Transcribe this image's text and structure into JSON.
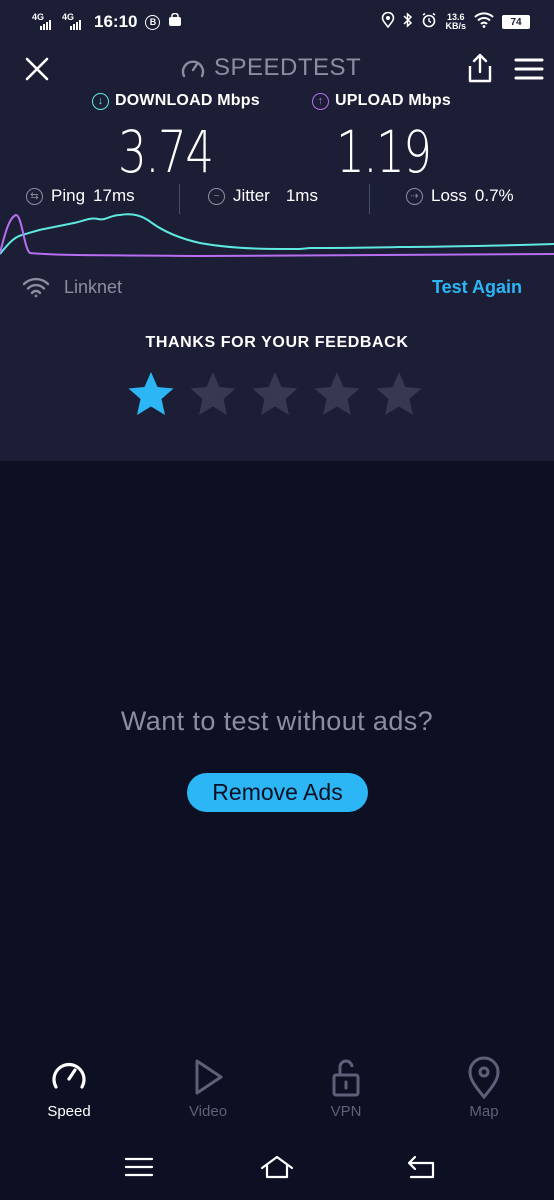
{
  "status_bar": {
    "network1": "4G",
    "network2": "4G",
    "time": "16:10",
    "badge_b": "B",
    "speed_value": "13.6",
    "speed_unit": "KB/s",
    "battery": "74"
  },
  "header": {
    "title": "SPEEDTEST"
  },
  "results": {
    "download_label": "DOWNLOAD Mbps",
    "download_value": "3.74",
    "upload_label": "UPLOAD Mbps",
    "upload_value": "1.19",
    "ping_label": "Ping",
    "ping_value": "17ms",
    "jitter_label": "Jitter",
    "jitter_value": "1ms",
    "loss_label": "Loss",
    "loss_value": "0.7%"
  },
  "connection": {
    "isp": "Linknet",
    "test_again_label": "Test Again"
  },
  "feedback": {
    "title": "THANKS FOR YOUR FEEDBACK",
    "rating": 1,
    "max_rating": 5
  },
  "promo": {
    "question": "Want to test without ads?",
    "button_label": "Remove Ads"
  },
  "tabs": [
    {
      "label": "Speed",
      "icon": "speedometer-icon",
      "active": true
    },
    {
      "label": "Video",
      "icon": "play-icon",
      "active": false
    },
    {
      "label": "VPN",
      "icon": "unlock-icon",
      "active": false
    },
    {
      "label": "Map",
      "icon": "map-pin-icon",
      "active": false
    }
  ],
  "colors": {
    "accent": "#2cb6f5",
    "download": "#5ee8e0",
    "upload": "#b86ef0",
    "panel": "#1c1e35",
    "background": "#0d0f22",
    "muted": "#8b8ea3"
  }
}
